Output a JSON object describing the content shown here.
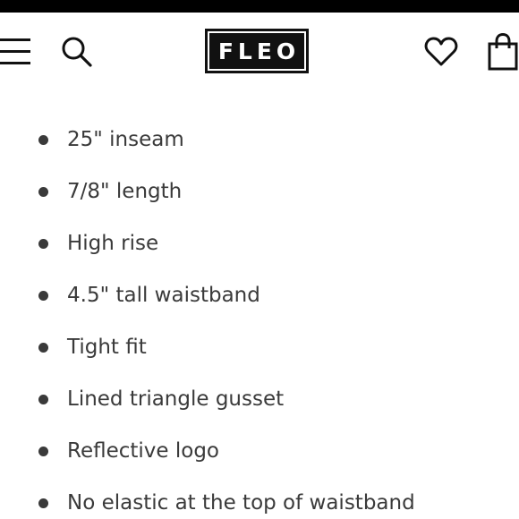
{
  "header": {
    "logo_text": "FLEO",
    "icons": [
      "menu-icon",
      "search-icon",
      "heart-icon",
      "shopping-bag-icon"
    ]
  },
  "features": [
    "25\" inseam",
    "7/8\" length",
    "High rise",
    "4.5\" tall waistband",
    "Tight fit",
    "Lined triangle gusset",
    "Reflective logo",
    "No elastic at the top of waistband"
  ],
  "colors": {
    "topbar": "#000000",
    "logo_background": "#111111",
    "text": "#3a3a3a",
    "background": "#ffffff"
  }
}
